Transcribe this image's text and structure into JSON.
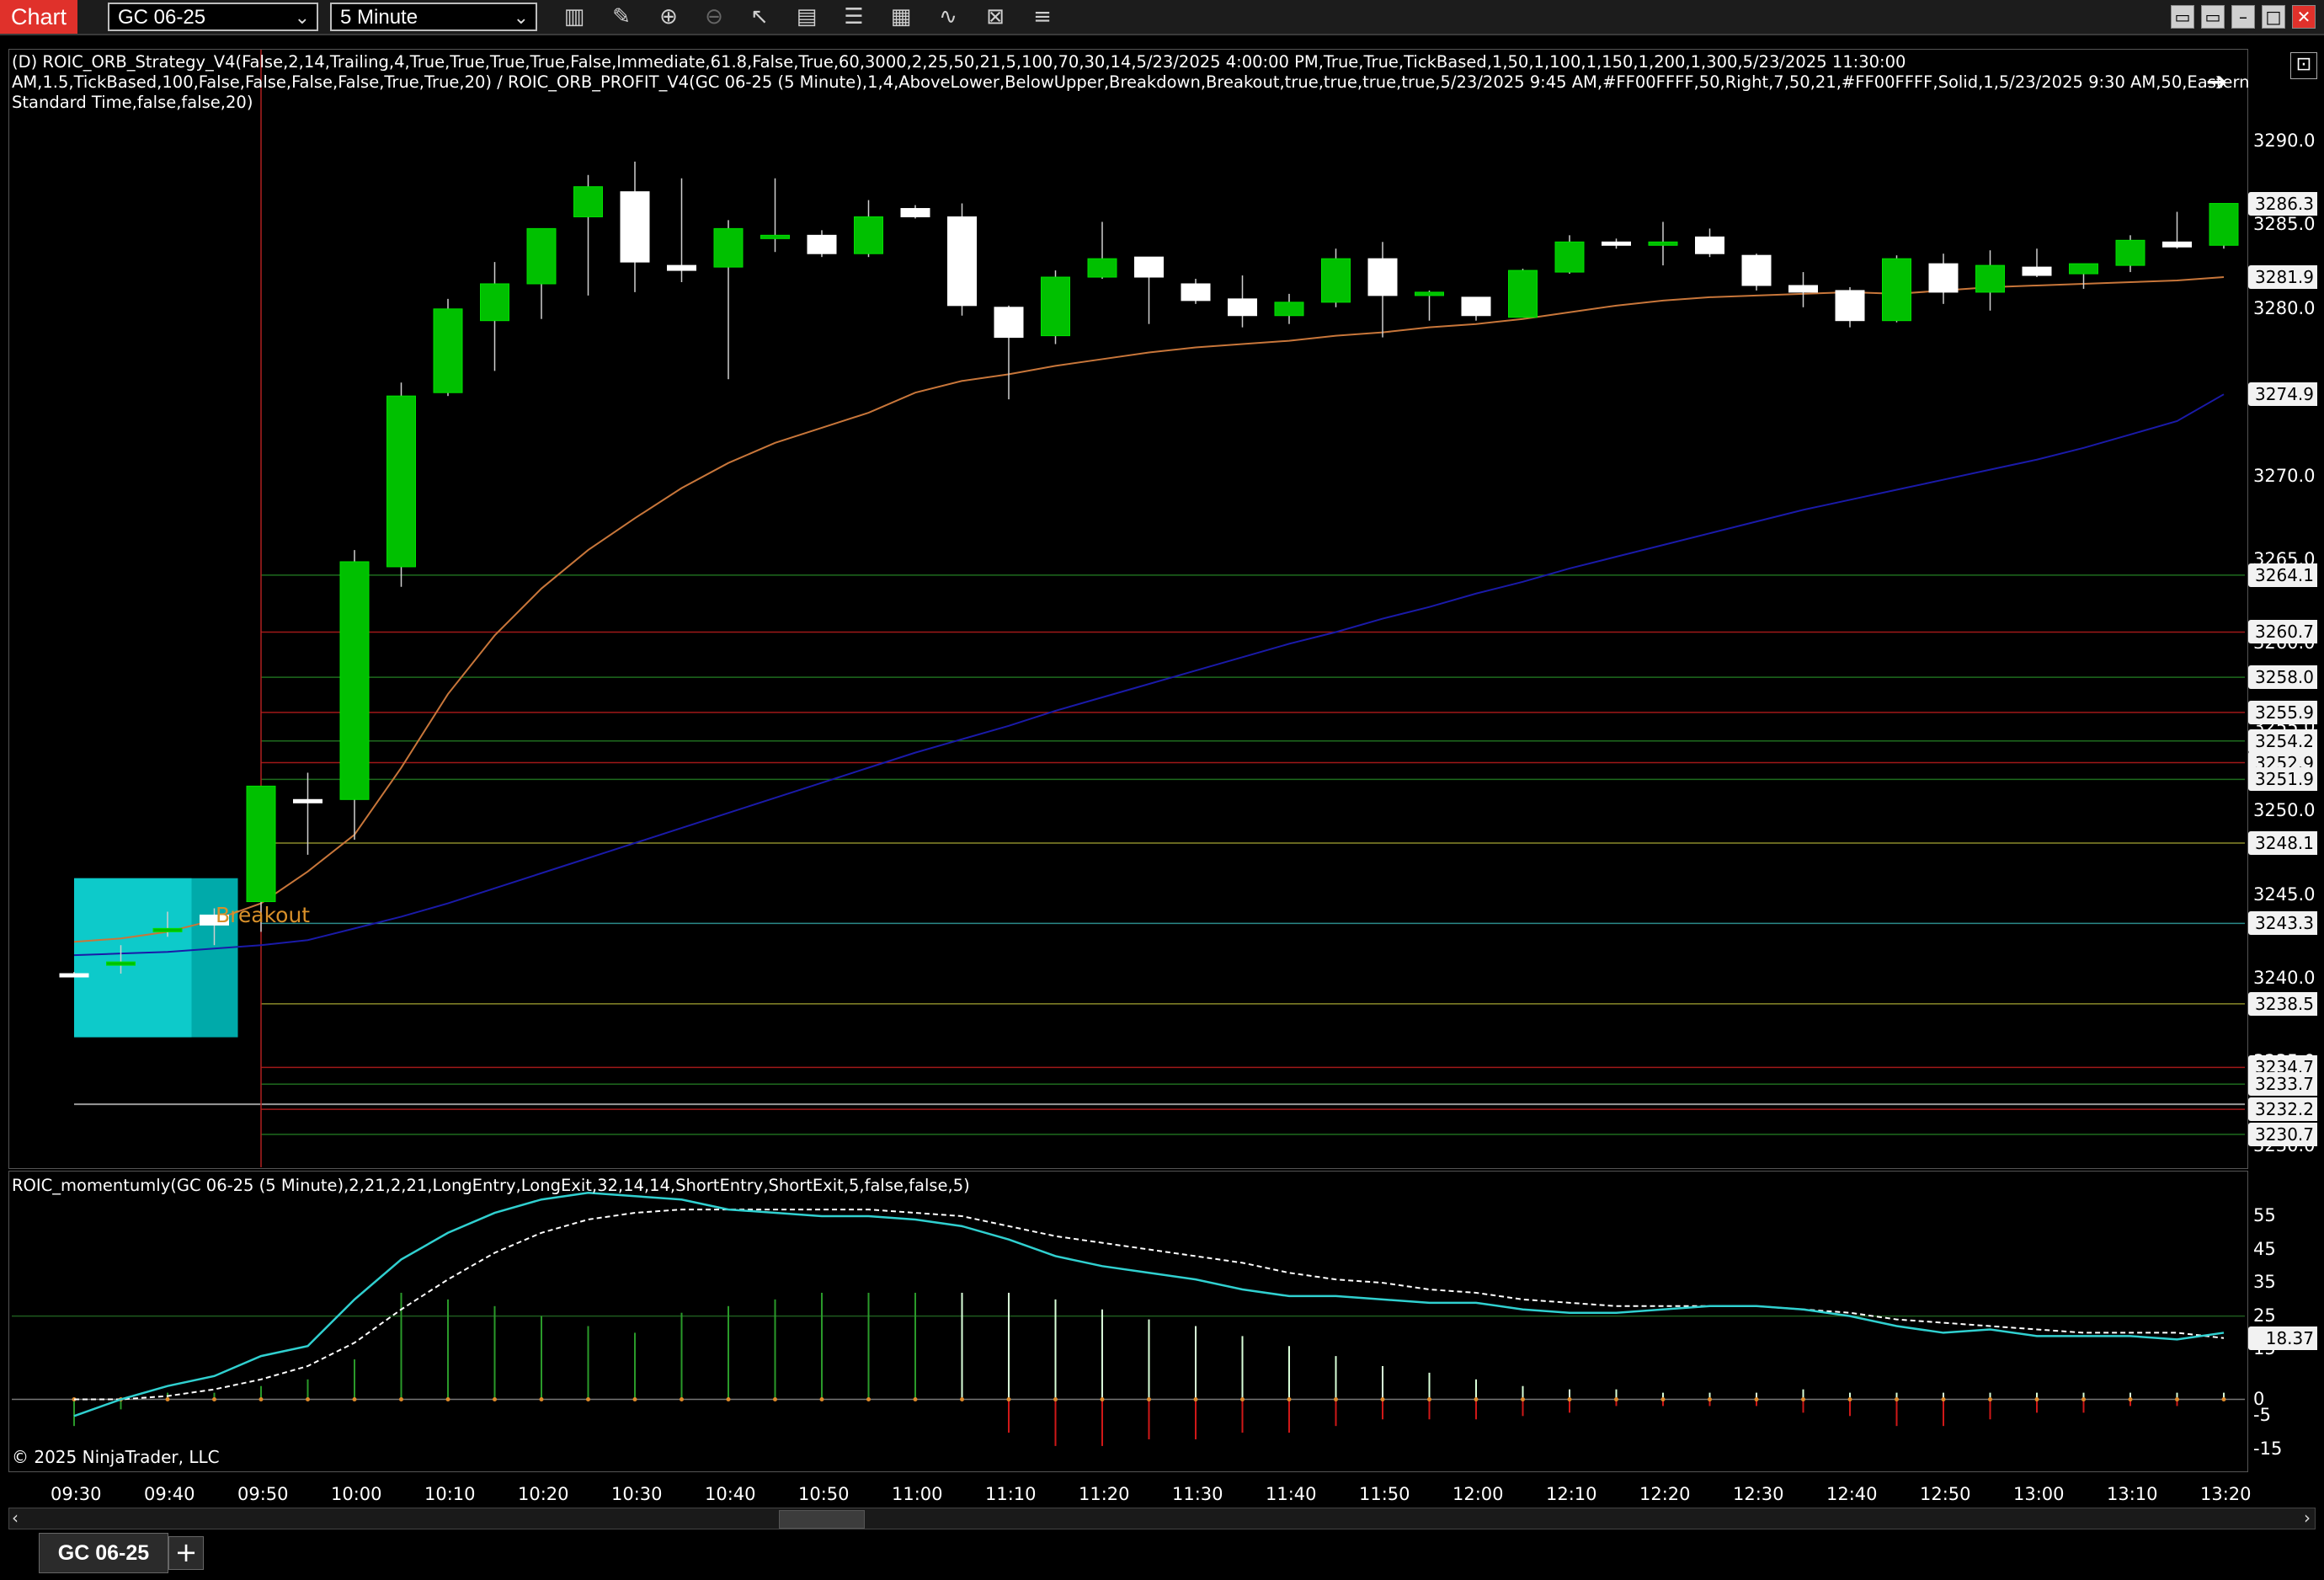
{
  "app": {
    "title": "Chart"
  },
  "toolbar": {
    "instrument": "GC 06-25",
    "interval": "5 Minute",
    "icons": [
      "bar-type-icon",
      "draw-tool-icon",
      "zoom-in-icon",
      "zoom-out-icon",
      "pointer-icon",
      "data-box-icon",
      "properties-icon",
      "strategies-icon",
      "indicators-icon",
      "chart-trader-icon",
      "list-icon"
    ]
  },
  "price_panel": {
    "indicator_text_1": "(D) ROIC_ORB_Strategy_V4(False,2,14,Trailing,4,True,True,True,True,False,Immediate,61.8,False,True,60,3000,2,25,50,21,5,100,70,30,14,5/23/2025 4:00:00 PM,True,True,TickBased,1,50,1,100,1,150,1,200,1,300,5/23/2025 11:30:00",
    "indicator_text_2": "AM,1.5,TickBased,100,False,False,False,False,True,True,20) / ROIC_ORB_PROFIT_V4(GC 06-25 (5 Minute),1,4,AboveLower,BelowUpper,Breakdown,Breakout,true,true,true,true,5/23/2025 9:45 AM,#FF00FFFF,50,Right,7,50,21,#FF00FFFF,Solid,1,5/23/2025 9:30 AM,50,Eastern",
    "indicator_text_3": "Standard Time,false,false,20)",
    "breakout_label": "Breakout"
  },
  "osc_panel": {
    "indicator_text": "ROIC_momentumly(GC 06-25 (5 Minute),2,21,2,21,LongEntry,LongExit,32,14,14,ShortEntry,ShortExit,5,false,false,5)",
    "copyright": "© 2025 NinjaTrader, LLC"
  },
  "colors": {
    "up_candle": "#00c000",
    "down_candle": "#ffffff",
    "ema_fast": "#c8763a",
    "ema_slow": "#1a1aa8",
    "orb_box": "#00c8c8",
    "momentum_line": "#30d0d0"
  },
  "chart_data": {
    "type": "candlestick",
    "instrument": "GC 06-25",
    "interval": "5 Minute",
    "price_axis_ticks": [
      "3290.0",
      "3285.0",
      "3280.0",
      "3275.0",
      "3270.0",
      "3265.0",
      "3260.0",
      "3255.0",
      "3250.0",
      "3245.0",
      "3240.0",
      "3235.0",
      "3230.0"
    ],
    "price_tags": [
      "3286.3",
      "3281.9",
      "3274.9",
      "3264.1",
      "3260.7",
      "3258.0",
      "3255.9",
      "3254.2",
      "3252.9",
      "3251.9",
      "3248.1",
      "3243.3",
      "3238.5",
      "3234.7",
      "3233.7",
      "3232.2",
      "3230.7"
    ],
    "time_labels": [
      "09:30",
      "09:40",
      "09:50",
      "10:00",
      "10:10",
      "10:20",
      "10:30",
      "10:40",
      "10:50",
      "11:00",
      "11:10",
      "11:20",
      "11:30",
      "11:40",
      "11:50",
      "12:00",
      "12:10",
      "12:20",
      "12:30",
      "12:40",
      "12:50",
      "13:00",
      "13:10",
      "13:20"
    ],
    "candles": [
      {
        "t": "09:30",
        "o": 3240.3,
        "h": 3240.4,
        "l": 3240.1,
        "c": 3240.2
      },
      {
        "t": "09:35",
        "o": 3240.8,
        "h": 3242.0,
        "l": 3240.3,
        "c": 3241.0
      },
      {
        "t": "09:40",
        "o": 3243.0,
        "h": 3244.0,
        "l": 3242.5,
        "c": 3243.0
      },
      {
        "t": "09:45",
        "o": 3243.8,
        "h": 3244.2,
        "l": 3242.0,
        "c": 3243.2
      },
      {
        "t": "09:50",
        "o": 3244.6,
        "h": 3251.5,
        "l": 3242.8,
        "c": 3251.5
      },
      {
        "t": "09:55",
        "o": 3250.7,
        "h": 3252.3,
        "l": 3247.4,
        "c": 3250.5
      },
      {
        "t": "10:00",
        "o": 3250.7,
        "h": 3265.6,
        "l": 3248.3,
        "c": 3264.9
      },
      {
        "t": "10:05",
        "o": 3264.6,
        "h": 3275.6,
        "l": 3263.4,
        "c": 3274.8
      },
      {
        "t": "10:10",
        "o": 3275.0,
        "h": 3280.6,
        "l": 3274.8,
        "c": 3280.0
      },
      {
        "t": "10:15",
        "o": 3279.3,
        "h": 3282.8,
        "l": 3276.3,
        "c": 3281.5
      },
      {
        "t": "10:20",
        "o": 3281.5,
        "h": 3284.8,
        "l": 3279.4,
        "c": 3284.8
      },
      {
        "t": "10:25",
        "o": 3285.5,
        "h": 3288.0,
        "l": 3280.8,
        "c": 3287.3
      },
      {
        "t": "10:30",
        "o": 3287.0,
        "h": 3288.8,
        "l": 3281.0,
        "c": 3282.8
      },
      {
        "t": "10:35",
        "o": 3282.6,
        "h": 3287.8,
        "l": 3281.6,
        "c": 3282.3
      },
      {
        "t": "10:40",
        "o": 3282.5,
        "h": 3285.3,
        "l": 3275.8,
        "c": 3284.8
      },
      {
        "t": "10:45",
        "o": 3284.4,
        "h": 3287.8,
        "l": 3283.4,
        "c": 3284.4
      },
      {
        "t": "10:50",
        "o": 3284.4,
        "h": 3284.7,
        "l": 3283.1,
        "c": 3283.3
      },
      {
        "t": "10:55",
        "o": 3283.3,
        "h": 3286.5,
        "l": 3283.1,
        "c": 3285.5
      },
      {
        "t": "11:00",
        "o": 3286.0,
        "h": 3286.2,
        "l": 3285.4,
        "c": 3285.5
      },
      {
        "t": "11:05",
        "o": 3285.5,
        "h": 3286.3,
        "l": 3279.6,
        "c": 3280.2
      },
      {
        "t": "11:10",
        "o": 3280.1,
        "h": 3280.2,
        "l": 3274.6,
        "c": 3278.3
      },
      {
        "t": "11:15",
        "o": 3278.4,
        "h": 3282.3,
        "l": 3277.9,
        "c": 3281.9
      },
      {
        "t": "11:20",
        "o": 3281.9,
        "h": 3285.2,
        "l": 3281.8,
        "c": 3283.0
      },
      {
        "t": "11:25",
        "o": 3283.1,
        "h": 3283.1,
        "l": 3279.1,
        "c": 3281.9
      },
      {
        "t": "11:30",
        "o": 3281.5,
        "h": 3281.8,
        "l": 3280.3,
        "c": 3280.5
      },
      {
        "t": "11:35",
        "o": 3280.6,
        "h": 3282.0,
        "l": 3278.9,
        "c": 3279.6
      },
      {
        "t": "11:40",
        "o": 3279.6,
        "h": 3280.9,
        "l": 3279.1,
        "c": 3280.4
      },
      {
        "t": "11:45",
        "o": 3280.4,
        "h": 3283.6,
        "l": 3280.1,
        "c": 3283.0
      },
      {
        "t": "11:50",
        "o": 3283.0,
        "h": 3284.0,
        "l": 3278.3,
        "c": 3280.8
      },
      {
        "t": "11:55",
        "o": 3281.0,
        "h": 3281.1,
        "l": 3279.3,
        "c": 3281.0
      },
      {
        "t": "12:00",
        "o": 3280.7,
        "h": 3280.7,
        "l": 3279.3,
        "c": 3279.6
      },
      {
        "t": "12:05",
        "o": 3279.5,
        "h": 3282.4,
        "l": 3279.5,
        "c": 3282.3
      },
      {
        "t": "12:10",
        "o": 3282.2,
        "h": 3284.4,
        "l": 3282.1,
        "c": 3284.0
      },
      {
        "t": "12:15",
        "o": 3284.0,
        "h": 3284.2,
        "l": 3283.6,
        "c": 3283.9
      },
      {
        "t": "12:20",
        "o": 3283.8,
        "h": 3285.2,
        "l": 3282.6,
        "c": 3284.0
      },
      {
        "t": "12:25",
        "o": 3284.3,
        "h": 3284.8,
        "l": 3283.1,
        "c": 3283.3
      },
      {
        "t": "12:30",
        "o": 3283.2,
        "h": 3283.3,
        "l": 3281.1,
        "c": 3281.4
      },
      {
        "t": "12:35",
        "o": 3281.4,
        "h": 3282.2,
        "l": 3280.1,
        "c": 3281.0
      },
      {
        "t": "12:40",
        "o": 3281.1,
        "h": 3281.3,
        "l": 3278.9,
        "c": 3279.3
      },
      {
        "t": "12:45",
        "o": 3279.3,
        "h": 3283.2,
        "l": 3279.2,
        "c": 3283.0
      },
      {
        "t": "12:50",
        "o": 3282.7,
        "h": 3283.3,
        "l": 3280.3,
        "c": 3281.0
      },
      {
        "t": "12:55",
        "o": 3281.0,
        "h": 3283.5,
        "l": 3279.9,
        "c": 3282.6
      },
      {
        "t": "13:00",
        "o": 3282.5,
        "h": 3283.6,
        "l": 3281.9,
        "c": 3282.0
      },
      {
        "t": "13:05",
        "o": 3282.1,
        "h": 3282.7,
        "l": 3281.2,
        "c": 3282.7
      },
      {
        "t": "13:10",
        "o": 3282.6,
        "h": 3284.4,
        "l": 3282.2,
        "c": 3284.1
      },
      {
        "t": "13:15",
        "o": 3284.0,
        "h": 3285.8,
        "l": 3283.6,
        "c": 3283.7
      },
      {
        "t": "13:20",
        "o": 3283.8,
        "h": 3286.3,
        "l": 3283.6,
        "c": 3286.3
      }
    ],
    "ema_fast": [
      3242.2,
      3242.4,
      3242.8,
      3243.5,
      3244.5,
      3246.4,
      3248.6,
      3252.6,
      3257.0,
      3260.5,
      3263.3,
      3265.6,
      3267.5,
      3269.3,
      3270.8,
      3272.0,
      3272.9,
      3273.8,
      3275.0,
      3275.7,
      3276.1,
      3276.6,
      3277.0,
      3277.4,
      3277.7,
      3277.9,
      3278.1,
      3278.4,
      3278.6,
      3278.9,
      3279.1,
      3279.4,
      3279.8,
      3280.2,
      3280.5,
      3280.7,
      3280.8,
      3280.9,
      3281.0,
      3280.9,
      3281.1,
      3281.3,
      3281.4,
      3281.5,
      3281.6,
      3281.7,
      3281.9
    ],
    "ema_slow": [
      3241.4,
      3241.5,
      3241.6,
      3241.8,
      3242.0,
      3242.3,
      3243.0,
      3243.7,
      3244.5,
      3245.4,
      3246.3,
      3247.2,
      3248.1,
      3249.0,
      3249.9,
      3250.8,
      3251.7,
      3252.6,
      3253.5,
      3254.3,
      3255.1,
      3256.0,
      3256.8,
      3257.6,
      3258.4,
      3259.2,
      3260.0,
      3260.7,
      3261.5,
      3262.2,
      3263.0,
      3263.7,
      3264.5,
      3265.2,
      3265.9,
      3266.6,
      3267.3,
      3268.0,
      3268.6,
      3269.2,
      3269.8,
      3270.4,
      3271.0,
      3271.7,
      3272.5,
      3273.3,
      3274.9
    ],
    "levels": [
      {
        "price": 3264.1,
        "color": "#1e6b1e"
      },
      {
        "price": 3260.7,
        "color": "#a01818"
      },
      {
        "price": 3258.0,
        "color": "#1e6b1e"
      },
      {
        "price": 3255.9,
        "color": "#a01818"
      },
      {
        "price": 3254.2,
        "color": "#1e6b1e"
      },
      {
        "price": 3252.9,
        "color": "#a01818"
      },
      {
        "price": 3251.9,
        "color": "#1e6b1e"
      },
      {
        "price": 3248.1,
        "color": "#8a8a2a"
      },
      {
        "price": 3243.3,
        "color": "#2a8a8a"
      },
      {
        "price": 3238.5,
        "color": "#8a8a2a"
      },
      {
        "price": 3234.7,
        "color": "#a01818"
      },
      {
        "price": 3233.7,
        "color": "#1e6b1e"
      },
      {
        "price": 3232.2,
        "color": "#a01818"
      },
      {
        "price": 3230.7,
        "color": "#1e6b1e"
      }
    ],
    "orb": {
      "high": 3246.0,
      "low": 3236.5,
      "mid": 3244.3,
      "start": "09:30",
      "end": "09:45"
    },
    "session_line": {
      "price": 3232.5
    },
    "oscillator": {
      "axis_ticks": [
        "55",
        "45",
        "35",
        "25",
        "15",
        "0",
        "-5",
        "-15"
      ],
      "current_value": "18.37",
      "momentum": [
        -5,
        0,
        4,
        7,
        13,
        16,
        30,
        42,
        50,
        56,
        60,
        62,
        61,
        60,
        57,
        56,
        55,
        55,
        54,
        52,
        48,
        43,
        40,
        38,
        36,
        33,
        31,
        31,
        30,
        29,
        29,
        27,
        26,
        26,
        27,
        28,
        28,
        27,
        25,
        22,
        20,
        21,
        19,
        19,
        19,
        18,
        20
      ],
      "signal": [
        0,
        0,
        1,
        3,
        6,
        10,
        17,
        27,
        36,
        44,
        50,
        54,
        56,
        57,
        57,
        57,
        57,
        57,
        56,
        55,
        52,
        49,
        47,
        45,
        43,
        41,
        38,
        36,
        35,
        33,
        32,
        30,
        29,
        28,
        28,
        28,
        28,
        27,
        26,
        24,
        23,
        22,
        21,
        20,
        20,
        20,
        18.4
      ],
      "histogram": [
        -8,
        -3,
        2,
        2,
        4,
        6,
        12,
        32,
        30,
        28,
        25,
        22,
        20,
        26,
        28,
        30,
        32,
        32,
        32,
        32,
        32,
        30,
        27,
        24,
        22,
        19,
        16,
        13,
        10,
        8,
        6,
        4,
        3,
        3,
        2,
        2,
        2,
        3,
        2,
        2,
        2,
        2,
        2,
        2,
        2,
        2,
        2
      ],
      "neg_histogram": [
        0,
        0,
        0,
        0,
        0,
        0,
        0,
        0,
        0,
        0,
        0,
        0,
        0,
        0,
        0,
        0,
        0,
        0,
        0,
        0,
        -10,
        -14,
        -14,
        -12,
        -12,
        -10,
        -10,
        -8,
        -6,
        -6,
        -6,
        -5,
        -4,
        -2,
        -2,
        -2,
        -2,
        -4,
        -5,
        -8,
        -8,
        -6,
        -4,
        -4,
        -2,
        -2,
        0
      ]
    }
  }
}
